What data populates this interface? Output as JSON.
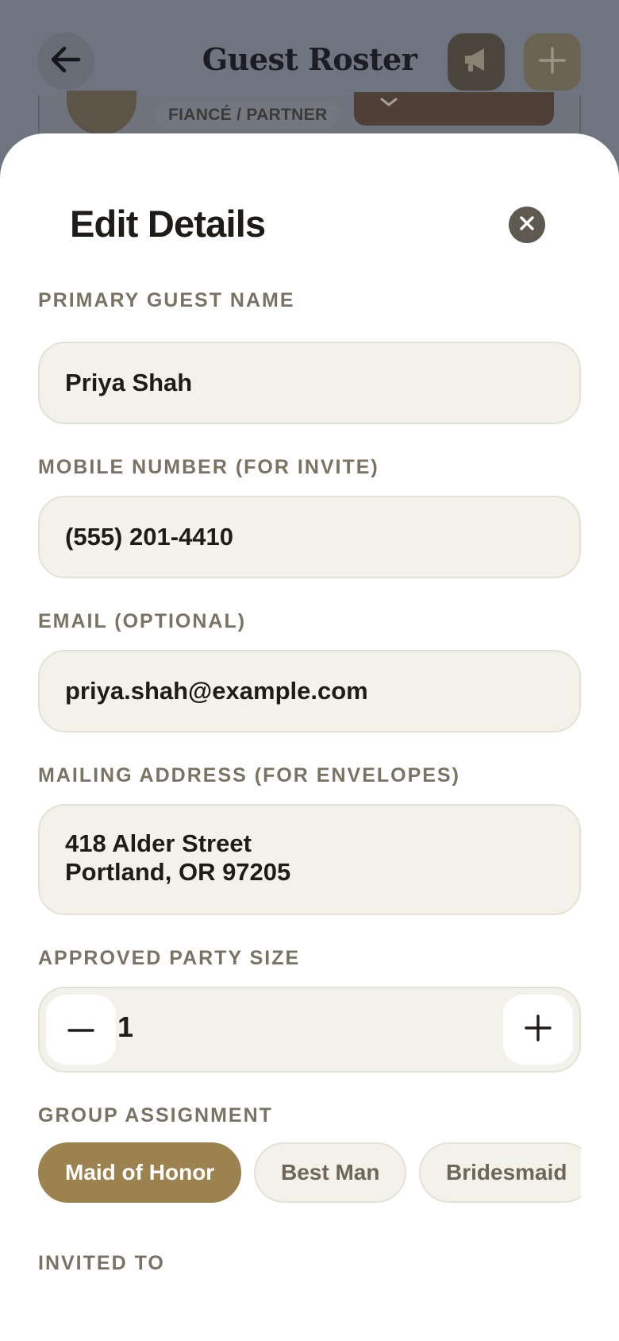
{
  "header": {
    "title": "Guest Roster",
    "back_icon": "arrow-left-icon",
    "megaphone_icon": "megaphone-icon",
    "add_icon": "plus-icon"
  },
  "background_card": {
    "tag": "FIANCÉ / PARTNER"
  },
  "sheet": {
    "title": "Edit Details",
    "close_icon": "close-icon"
  },
  "fields": {
    "name": {
      "label": "PRIMARY GUEST NAME",
      "value": "Priya Shah"
    },
    "mobile": {
      "label": "MOBILE NUMBER (FOR INVITE)",
      "value": "(555) 201-4410"
    },
    "email": {
      "label": "EMAIL (OPTIONAL)",
      "value": "priya.shah@example.com"
    },
    "address": {
      "label": "MAILING ADDRESS (FOR ENVELOPES)",
      "line1": "418 Alder Street",
      "line2": "Portland, OR 97205"
    },
    "party_size": {
      "label": "APPROVED PARTY SIZE",
      "value": "1"
    }
  },
  "group_assignment": {
    "label": "GROUP ASSIGNMENT",
    "options": [
      "Maid of Honor",
      "Best Man",
      "Bridesmaid"
    ],
    "selected": "Maid of Honor"
  },
  "invited_to": {
    "label": "INVITED TO"
  },
  "colors": {
    "accent": "#9c824f",
    "field_bg": "#f2f2ea",
    "label": "#7a7263",
    "overlay": "#6e7480"
  }
}
